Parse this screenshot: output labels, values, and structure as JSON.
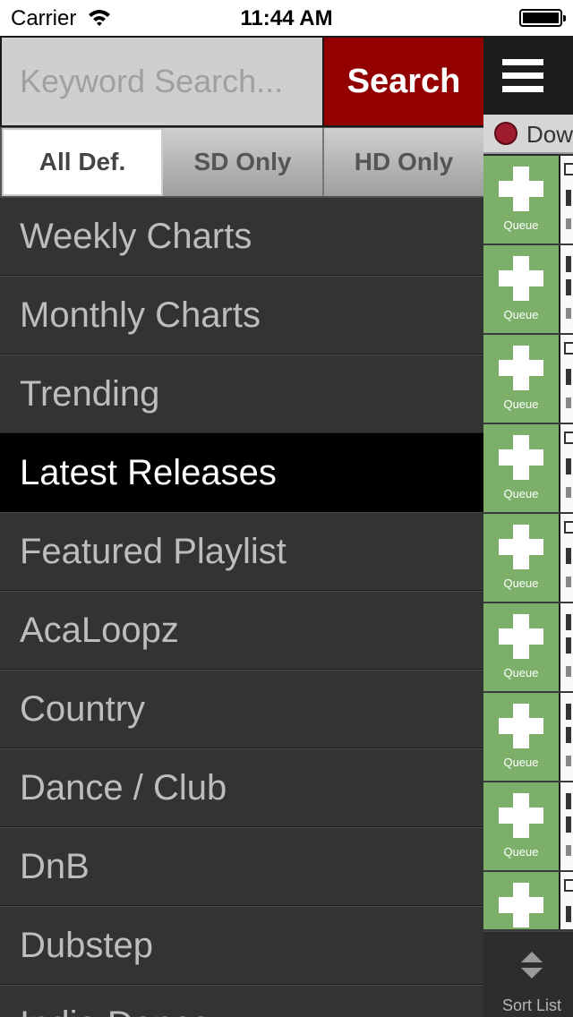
{
  "status_bar": {
    "carrier": "Carrier",
    "time": "11:44 AM"
  },
  "search": {
    "placeholder": "Keyword Search...",
    "button_label": "Search"
  },
  "filters": [
    {
      "label": "All Def.",
      "active": true
    },
    {
      "label": "SD Only",
      "active": false
    },
    {
      "label": "HD Only",
      "active": false
    }
  ],
  "menu": [
    {
      "label": "Weekly Charts"
    },
    {
      "label": "Monthly Charts"
    },
    {
      "label": "Trending"
    },
    {
      "label": "Latest Releases",
      "selected": true
    },
    {
      "label": "Featured Playlist"
    },
    {
      "label": "AcaLoopz"
    },
    {
      "label": "Country"
    },
    {
      "label": "Dance / Club"
    },
    {
      "label": "DnB"
    },
    {
      "label": "Dubstep"
    },
    {
      "label": "Indie Dance"
    }
  ],
  "peek": {
    "download_label": "Dow",
    "queue_label": "Queue",
    "sort_label": "Sort List"
  },
  "colors": {
    "search_button": "#930000",
    "queue_green": "#7cb06a",
    "download_dot": "#9d1c2d"
  }
}
